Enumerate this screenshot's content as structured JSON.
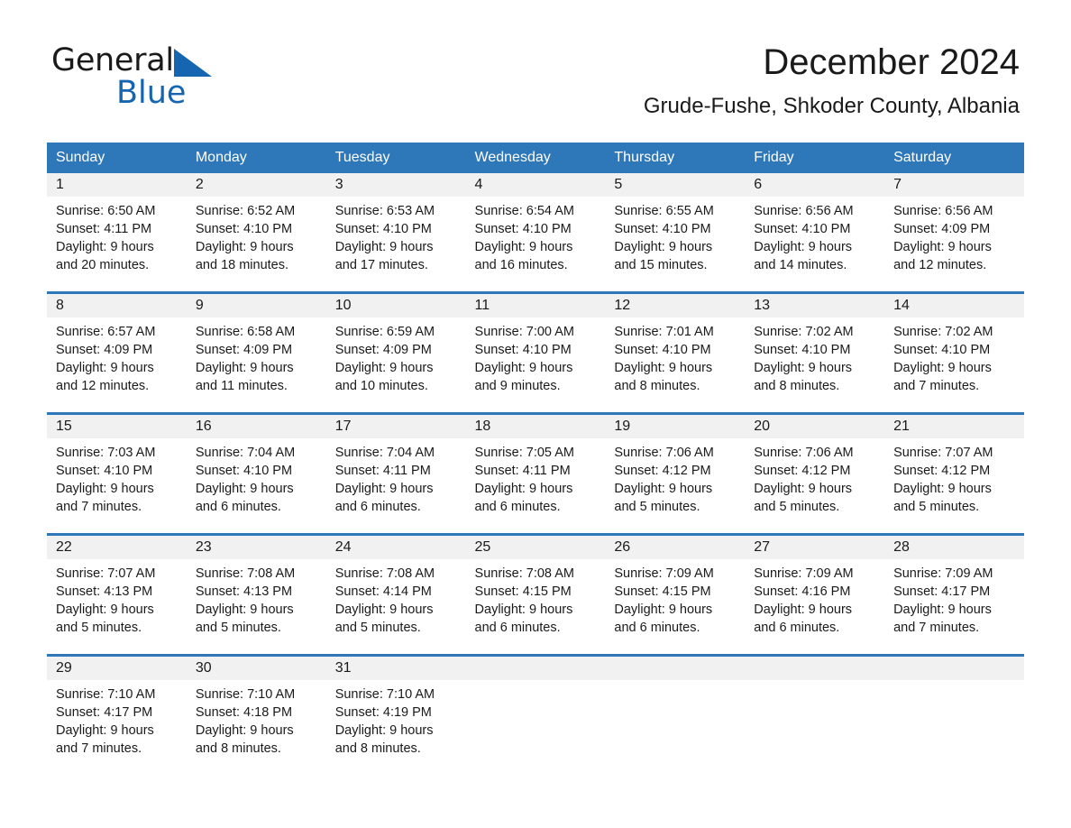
{
  "brand": {
    "name_part1": "General",
    "name_part2": "Blue",
    "flag_icon": "triangle-flag-icon",
    "accent_color": "#1565b0"
  },
  "header": {
    "month_title": "December 2024",
    "location": "Grude-Fushe, Shkoder County, Albania"
  },
  "theme": {
    "header_blue": "#2e77b8",
    "daynum_band_gray": "#f1f1f1",
    "text_color": "#1a1a1a"
  },
  "weekday_headers": [
    "Sunday",
    "Monday",
    "Tuesday",
    "Wednesday",
    "Thursday",
    "Friday",
    "Saturday"
  ],
  "weeks": [
    [
      {
        "day": "1",
        "sunrise": "Sunrise: 6:50 AM",
        "sunset": "Sunset: 4:11 PM",
        "daylight_line1": "Daylight: 9 hours",
        "daylight_line2": "and 20 minutes."
      },
      {
        "day": "2",
        "sunrise": "Sunrise: 6:52 AM",
        "sunset": "Sunset: 4:10 PM",
        "daylight_line1": "Daylight: 9 hours",
        "daylight_line2": "and 18 minutes."
      },
      {
        "day": "3",
        "sunrise": "Sunrise: 6:53 AM",
        "sunset": "Sunset: 4:10 PM",
        "daylight_line1": "Daylight: 9 hours",
        "daylight_line2": "and 17 minutes."
      },
      {
        "day": "4",
        "sunrise": "Sunrise: 6:54 AM",
        "sunset": "Sunset: 4:10 PM",
        "daylight_line1": "Daylight: 9 hours",
        "daylight_line2": "and 16 minutes."
      },
      {
        "day": "5",
        "sunrise": "Sunrise: 6:55 AM",
        "sunset": "Sunset: 4:10 PM",
        "daylight_line1": "Daylight: 9 hours",
        "daylight_line2": "and 15 minutes."
      },
      {
        "day": "6",
        "sunrise": "Sunrise: 6:56 AM",
        "sunset": "Sunset: 4:10 PM",
        "daylight_line1": "Daylight: 9 hours",
        "daylight_line2": "and 14 minutes."
      },
      {
        "day": "7",
        "sunrise": "Sunrise: 6:56 AM",
        "sunset": "Sunset: 4:09 PM",
        "daylight_line1": "Daylight: 9 hours",
        "daylight_line2": "and 12 minutes."
      }
    ],
    [
      {
        "day": "8",
        "sunrise": "Sunrise: 6:57 AM",
        "sunset": "Sunset: 4:09 PM",
        "daylight_line1": "Daylight: 9 hours",
        "daylight_line2": "and 12 minutes."
      },
      {
        "day": "9",
        "sunrise": "Sunrise: 6:58 AM",
        "sunset": "Sunset: 4:09 PM",
        "daylight_line1": "Daylight: 9 hours",
        "daylight_line2": "and 11 minutes."
      },
      {
        "day": "10",
        "sunrise": "Sunrise: 6:59 AM",
        "sunset": "Sunset: 4:09 PM",
        "daylight_line1": "Daylight: 9 hours",
        "daylight_line2": "and 10 minutes."
      },
      {
        "day": "11",
        "sunrise": "Sunrise: 7:00 AM",
        "sunset": "Sunset: 4:10 PM",
        "daylight_line1": "Daylight: 9 hours",
        "daylight_line2": "and 9 minutes."
      },
      {
        "day": "12",
        "sunrise": "Sunrise: 7:01 AM",
        "sunset": "Sunset: 4:10 PM",
        "daylight_line1": "Daylight: 9 hours",
        "daylight_line2": "and 8 minutes."
      },
      {
        "day": "13",
        "sunrise": "Sunrise: 7:02 AM",
        "sunset": "Sunset: 4:10 PM",
        "daylight_line1": "Daylight: 9 hours",
        "daylight_line2": "and 8 minutes."
      },
      {
        "day": "14",
        "sunrise": "Sunrise: 7:02 AM",
        "sunset": "Sunset: 4:10 PM",
        "daylight_line1": "Daylight: 9 hours",
        "daylight_line2": "and 7 minutes."
      }
    ],
    [
      {
        "day": "15",
        "sunrise": "Sunrise: 7:03 AM",
        "sunset": "Sunset: 4:10 PM",
        "daylight_line1": "Daylight: 9 hours",
        "daylight_line2": "and 7 minutes."
      },
      {
        "day": "16",
        "sunrise": "Sunrise: 7:04 AM",
        "sunset": "Sunset: 4:10 PM",
        "daylight_line1": "Daylight: 9 hours",
        "daylight_line2": "and 6 minutes."
      },
      {
        "day": "17",
        "sunrise": "Sunrise: 7:04 AM",
        "sunset": "Sunset: 4:11 PM",
        "daylight_line1": "Daylight: 9 hours",
        "daylight_line2": "and 6 minutes."
      },
      {
        "day": "18",
        "sunrise": "Sunrise: 7:05 AM",
        "sunset": "Sunset: 4:11 PM",
        "daylight_line1": "Daylight: 9 hours",
        "daylight_line2": "and 6 minutes."
      },
      {
        "day": "19",
        "sunrise": "Sunrise: 7:06 AM",
        "sunset": "Sunset: 4:12 PM",
        "daylight_line1": "Daylight: 9 hours",
        "daylight_line2": "and 5 minutes."
      },
      {
        "day": "20",
        "sunrise": "Sunrise: 7:06 AM",
        "sunset": "Sunset: 4:12 PM",
        "daylight_line1": "Daylight: 9 hours",
        "daylight_line2": "and 5 minutes."
      },
      {
        "day": "21",
        "sunrise": "Sunrise: 7:07 AM",
        "sunset": "Sunset: 4:12 PM",
        "daylight_line1": "Daylight: 9 hours",
        "daylight_line2": "and 5 minutes."
      }
    ],
    [
      {
        "day": "22",
        "sunrise": "Sunrise: 7:07 AM",
        "sunset": "Sunset: 4:13 PM",
        "daylight_line1": "Daylight: 9 hours",
        "daylight_line2": "and 5 minutes."
      },
      {
        "day": "23",
        "sunrise": "Sunrise: 7:08 AM",
        "sunset": "Sunset: 4:13 PM",
        "daylight_line1": "Daylight: 9 hours",
        "daylight_line2": "and 5 minutes."
      },
      {
        "day": "24",
        "sunrise": "Sunrise: 7:08 AM",
        "sunset": "Sunset: 4:14 PM",
        "daylight_line1": "Daylight: 9 hours",
        "daylight_line2": "and 5 minutes."
      },
      {
        "day": "25",
        "sunrise": "Sunrise: 7:08 AM",
        "sunset": "Sunset: 4:15 PM",
        "daylight_line1": "Daylight: 9 hours",
        "daylight_line2": "and 6 minutes."
      },
      {
        "day": "26",
        "sunrise": "Sunrise: 7:09 AM",
        "sunset": "Sunset: 4:15 PM",
        "daylight_line1": "Daylight: 9 hours",
        "daylight_line2": "and 6 minutes."
      },
      {
        "day": "27",
        "sunrise": "Sunrise: 7:09 AM",
        "sunset": "Sunset: 4:16 PM",
        "daylight_line1": "Daylight: 9 hours",
        "daylight_line2": "and 6 minutes."
      },
      {
        "day": "28",
        "sunrise": "Sunrise: 7:09 AM",
        "sunset": "Sunset: 4:17 PM",
        "daylight_line1": "Daylight: 9 hours",
        "daylight_line2": "and 7 minutes."
      }
    ],
    [
      {
        "day": "29",
        "sunrise": "Sunrise: 7:10 AM",
        "sunset": "Sunset: 4:17 PM",
        "daylight_line1": "Daylight: 9 hours",
        "daylight_line2": "and 7 minutes."
      },
      {
        "day": "30",
        "sunrise": "Sunrise: 7:10 AM",
        "sunset": "Sunset: 4:18 PM",
        "daylight_line1": "Daylight: 9 hours",
        "daylight_line2": "and 8 minutes."
      },
      {
        "day": "31",
        "sunrise": "Sunrise: 7:10 AM",
        "sunset": "Sunset: 4:19 PM",
        "daylight_line1": "Daylight: 9 hours",
        "daylight_line2": "and 8 minutes."
      },
      {
        "day": "",
        "sunrise": "",
        "sunset": "",
        "daylight_line1": "",
        "daylight_line2": ""
      },
      {
        "day": "",
        "sunrise": "",
        "sunset": "",
        "daylight_line1": "",
        "daylight_line2": ""
      },
      {
        "day": "",
        "sunrise": "",
        "sunset": "",
        "daylight_line1": "",
        "daylight_line2": ""
      },
      {
        "day": "",
        "sunrise": "",
        "sunset": "",
        "daylight_line1": "",
        "daylight_line2": ""
      }
    ]
  ]
}
